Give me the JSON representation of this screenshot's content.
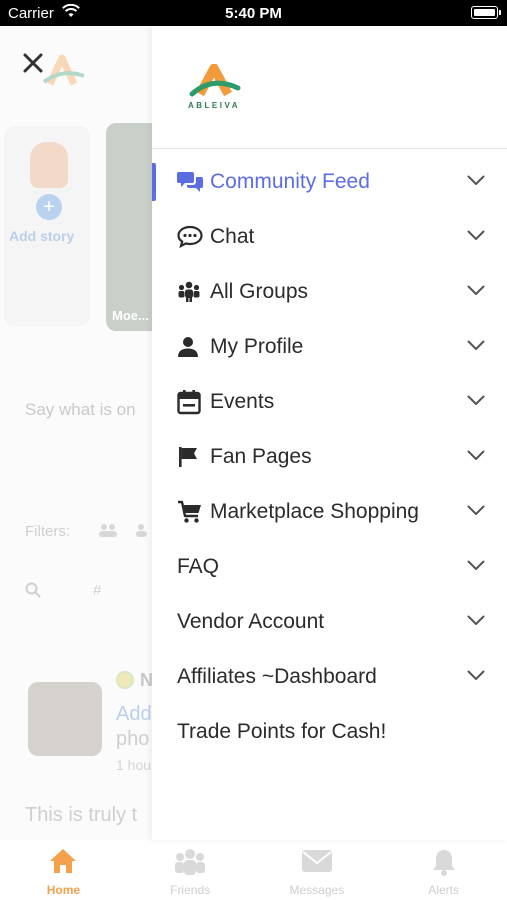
{
  "status_bar": {
    "carrier": "Carrier",
    "time": "5:40 PM"
  },
  "brand": {
    "name": "ABLEIVA",
    "accent": "#5b6ee1",
    "logo_orange": "#f39a3a",
    "logo_green": "#2f9a6a"
  },
  "background_page": {
    "story_add_label": "Add story",
    "story_photo_label": "Moe...",
    "composer_placeholder": "Say what is on",
    "filters_label": "Filters:",
    "search_symbol": "#",
    "post_author_initial": "N",
    "post_line1": "Add",
    "post_line2": "pho",
    "post_time": "1 hou",
    "post_text": "This is truly t"
  },
  "drawer": {
    "items": [
      {
        "label": "Community Feed",
        "icon": "chat-bubbles-icon",
        "active": true
      },
      {
        "label": "Chat",
        "icon": "speech-bubble-icon",
        "active": false
      },
      {
        "label": "All Groups",
        "icon": "groups-icon",
        "active": false
      },
      {
        "label": "My Profile",
        "icon": "user-icon",
        "active": false
      },
      {
        "label": "Events",
        "icon": "calendar-icon",
        "active": false
      },
      {
        "label": "Fan Pages",
        "icon": "flag-icon",
        "active": false
      },
      {
        "label": "Marketplace Shopping",
        "icon": "cart-icon",
        "active": false
      },
      {
        "label": "FAQ",
        "icon": "",
        "active": false
      },
      {
        "label": "Vendor Account",
        "icon": "",
        "active": false
      },
      {
        "label": "Affiliates ~Dashboard",
        "icon": "",
        "active": false
      },
      {
        "label": "Trade Points for Cash!",
        "icon": "",
        "active": false
      }
    ]
  },
  "tab_bar": {
    "tabs": [
      {
        "label": "Home",
        "icon": "home-icon",
        "active": true
      },
      {
        "label": "Friends",
        "icon": "friends-icon",
        "active": false
      },
      {
        "label": "Messages",
        "icon": "envelope-icon",
        "active": false
      },
      {
        "label": "Alerts",
        "icon": "bell-icon",
        "active": false
      }
    ]
  }
}
